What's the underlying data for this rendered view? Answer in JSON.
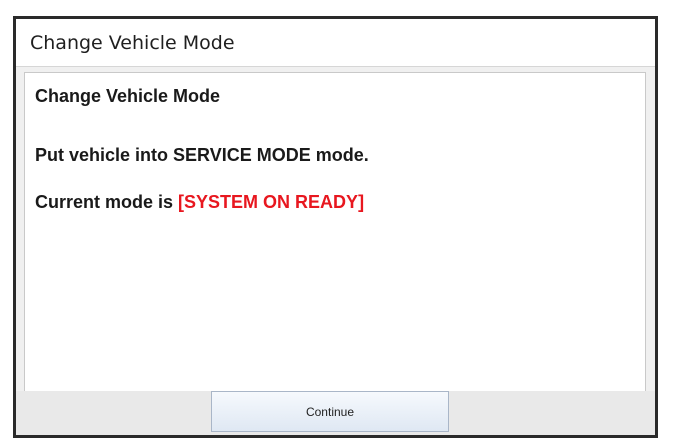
{
  "dialog": {
    "title": "Change Vehicle Mode",
    "heading": "Change Vehicle Mode",
    "instruction": "Put vehicle into SERVICE MODE mode.",
    "current_mode_prefix": "Current mode is",
    "current_mode_value": "[SYSTEM ON READY]",
    "continue_label": "Continue"
  },
  "colors": {
    "mode_value": "#e8171f",
    "button_border": "#a9b6c8"
  }
}
